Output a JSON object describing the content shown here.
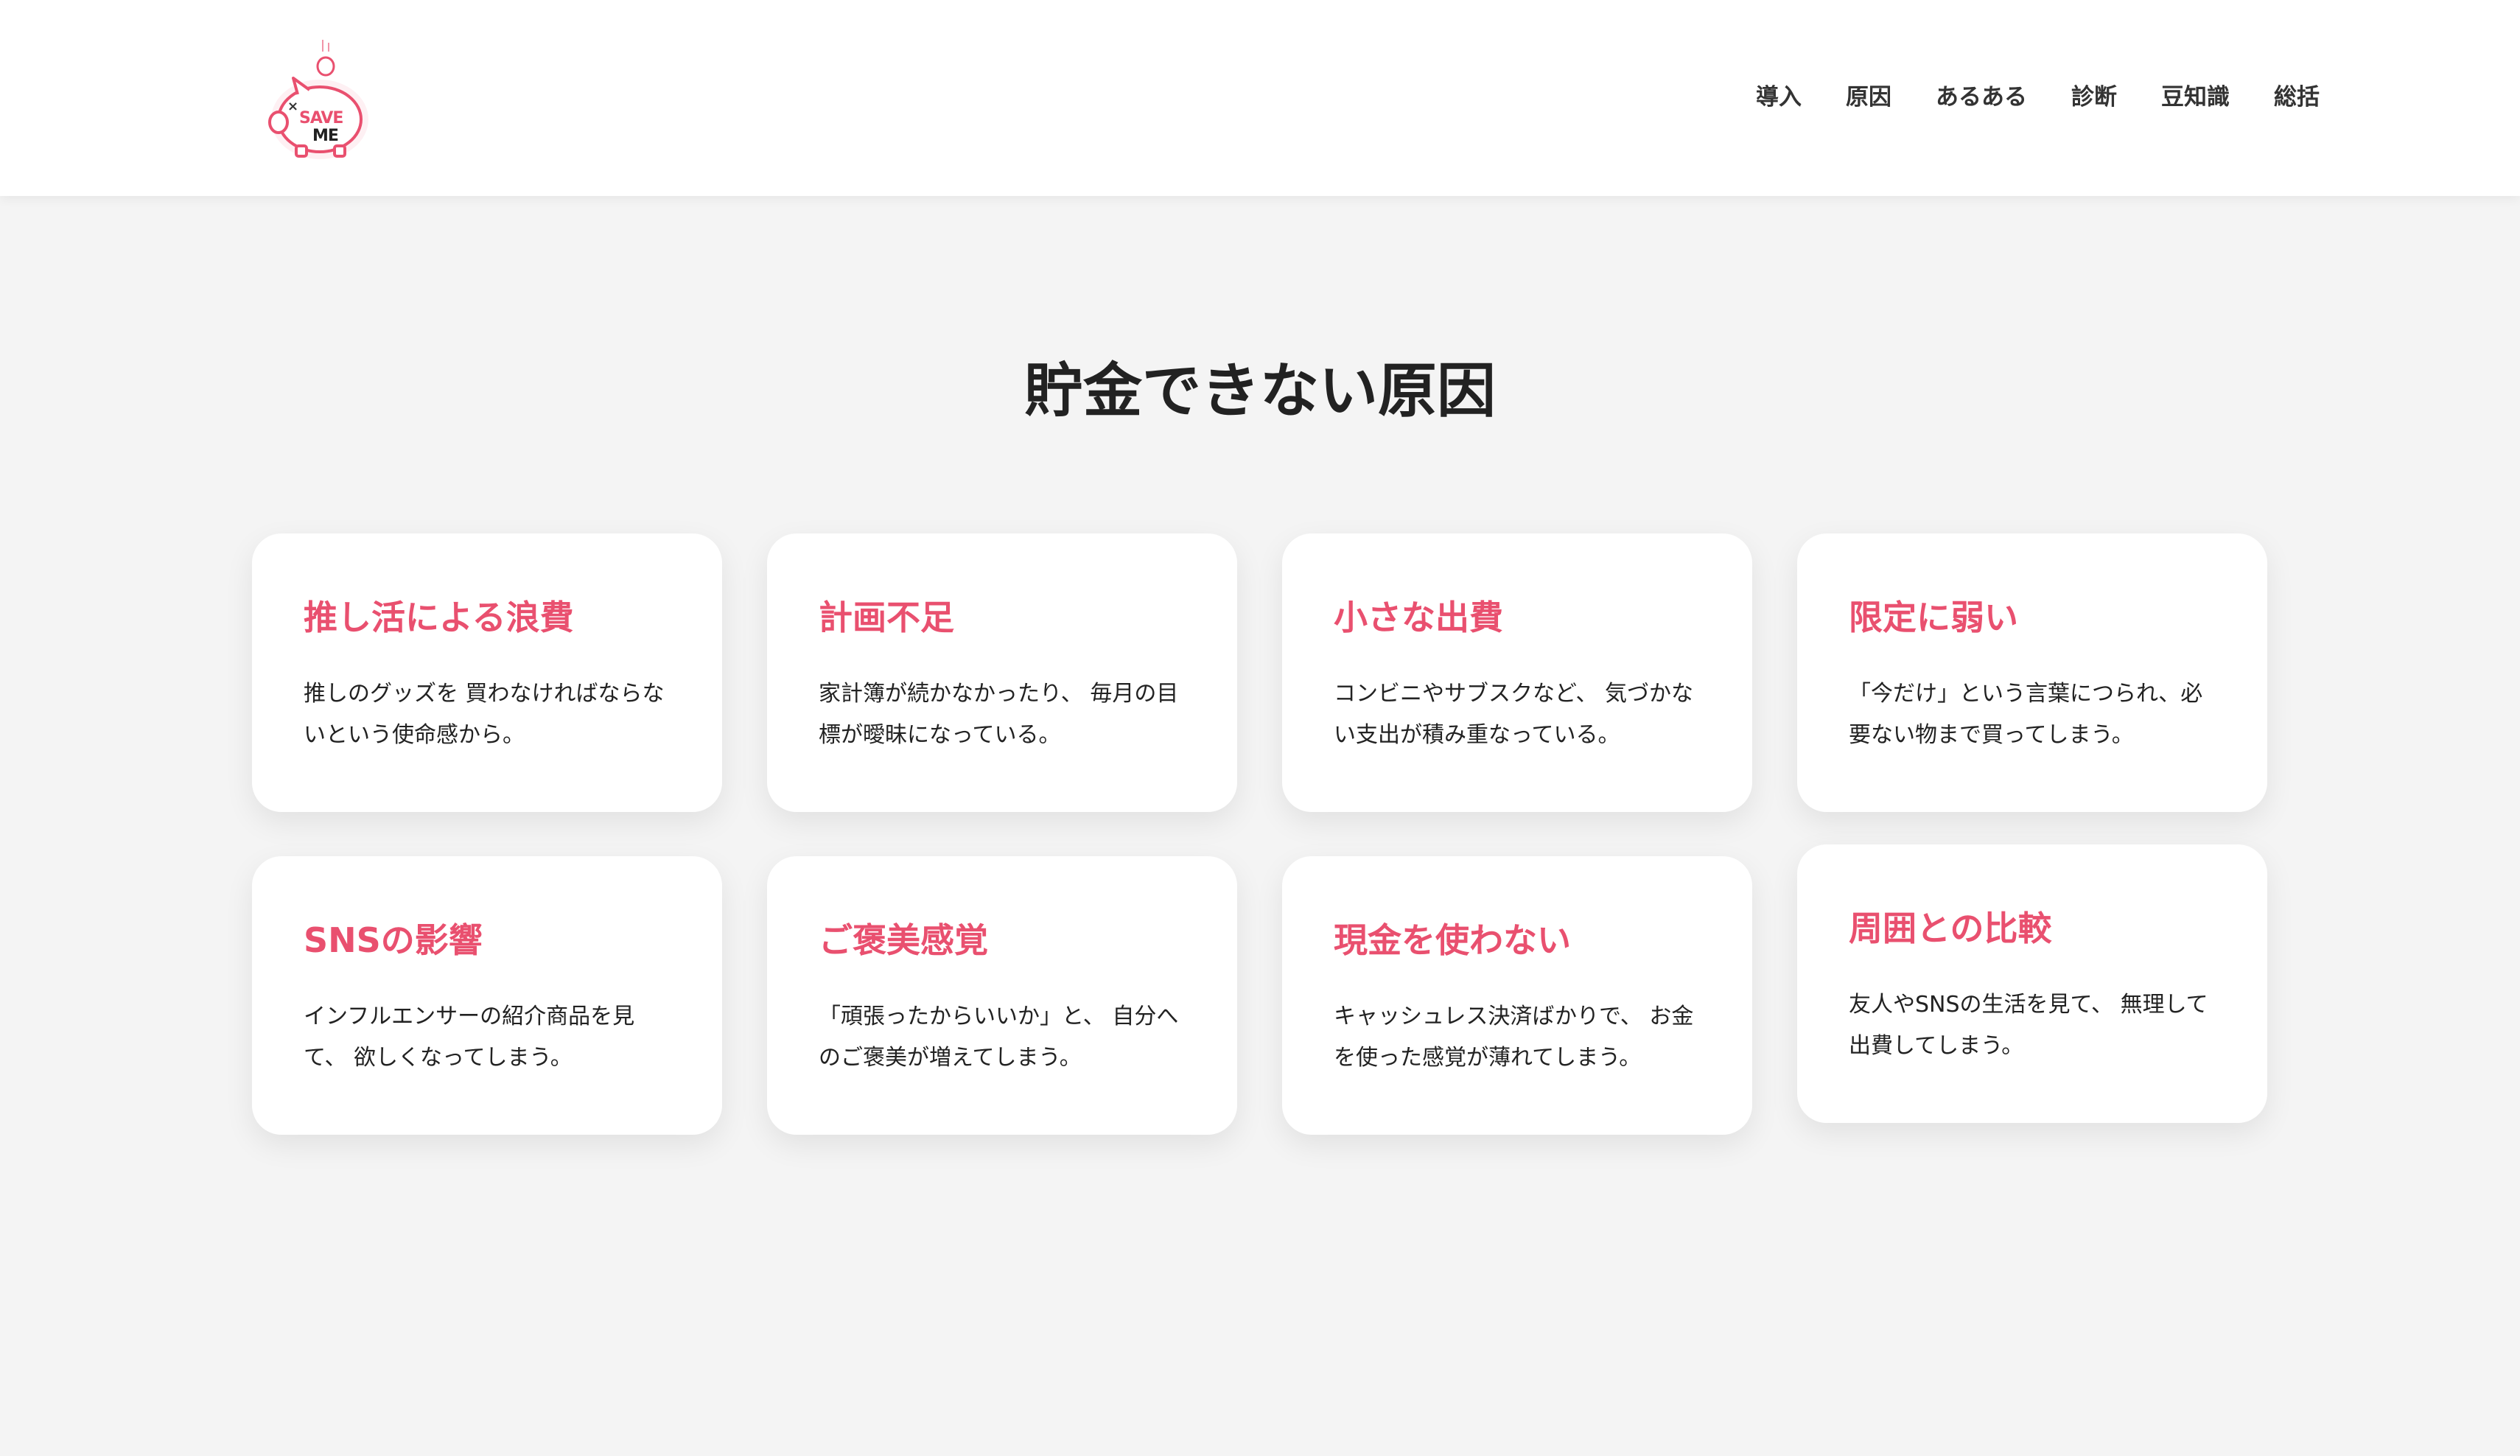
{
  "logo": {
    "line1": "SAVE",
    "line2": "ME",
    "mark": "×",
    "icon": "piggy-bank-icon",
    "accent": "#e9506f"
  },
  "nav": {
    "items": [
      "導入",
      "原因",
      "あるある",
      "診断",
      "豆知識",
      "総括"
    ]
  },
  "section": {
    "title": "貯金できない原因"
  },
  "cards": [
    {
      "title": "推し活による浪費",
      "text": "推しのグッズを 買わなければならないという使命感から。"
    },
    {
      "title": "計画不足",
      "text": "家計簿が続かなかったり、 毎月の目標が曖昧になっている。"
    },
    {
      "title": "小さな出費",
      "text": "コンビニやサブスクなど、 気づかない支出が積み重なっている。"
    },
    {
      "title": "限定に弱い",
      "text": "「今だけ」という言葉につられ、必要ない物まで買ってしまう。"
    },
    {
      "title": "SNSの影響",
      "text": "インフルエンサーの紹介商品を見て、 欲しくなってしまう。"
    },
    {
      "title": "ご褒美感覚",
      "text": "「頑張ったからいいか」と、 自分へのご褒美が増えてしまう。"
    },
    {
      "title": "現金を使わない",
      "text": "キャッシュレス決済ばかりで、 お金を使った感覚が薄れてしまう。"
    },
    {
      "title": "周囲との比較",
      "text": "友人やSNSの生活を見て、 無理して出費してしまう。"
    }
  ],
  "colors": {
    "accent": "#e9506f",
    "background": "#f4f4f4",
    "card": "#ffffff",
    "text": "#222222"
  }
}
